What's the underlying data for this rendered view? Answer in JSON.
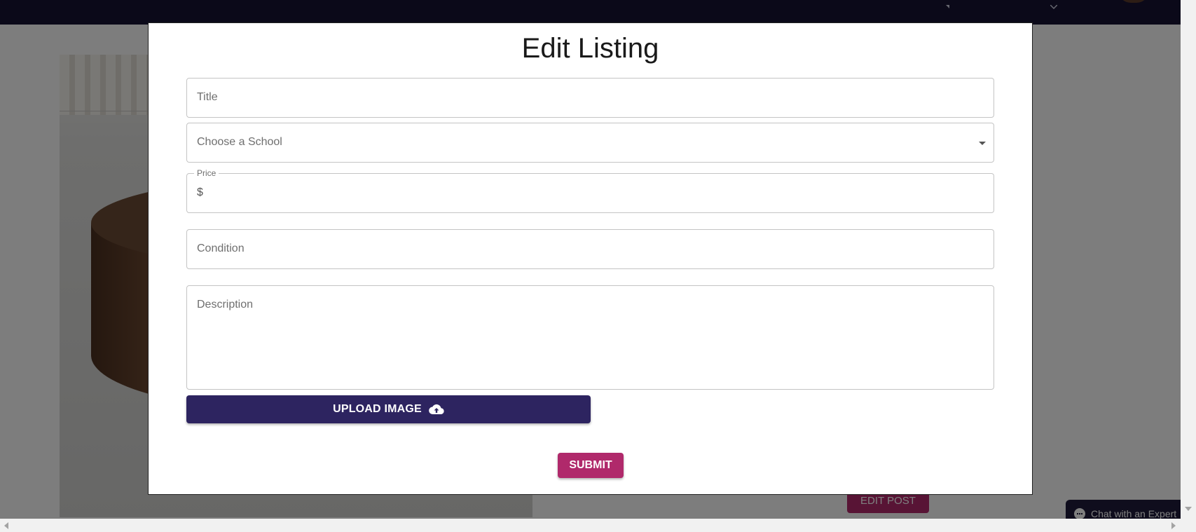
{
  "background_page": {
    "edit_post_label": "EDIT POST",
    "chat_label": "Chat with an Expert"
  },
  "modal": {
    "title": "Edit Listing",
    "fields": {
      "title_placeholder": "Title",
      "school_placeholder": "Choose a School",
      "price_label": "Price",
      "price_prefix": "$",
      "condition_placeholder": "Condition",
      "description_placeholder": "Description"
    },
    "upload_label": "UPLOAD IMAGE",
    "upload_icon": "cloud-upload-icon",
    "submit_label": "SUBMIT"
  },
  "colors": {
    "topbar": "#171333",
    "primary_button": "#2d2460",
    "accent_button": "#b0296b"
  }
}
